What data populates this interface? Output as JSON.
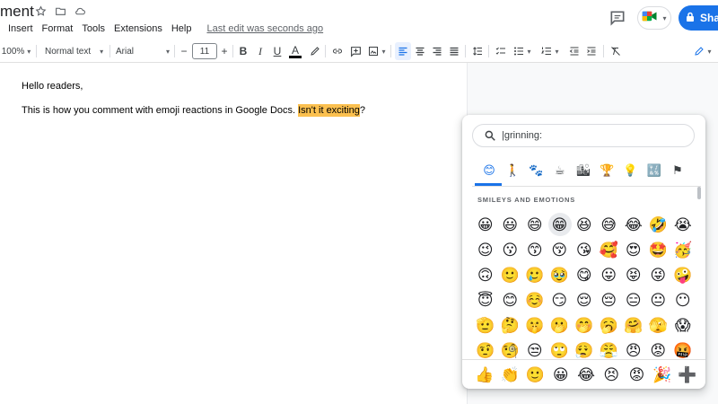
{
  "doc": {
    "title_fragment": "ment",
    "last_edit": "Last edit was seconds ago",
    "paragraph1": "Hello readers,",
    "paragraph2_plain": "This is how you comment with emoji reactions in Google Docs. ",
    "paragraph2_highlight": "Isn't it exciting",
    "paragraph2_end": "?"
  },
  "menu": [
    "Insert",
    "Format",
    "Tools",
    "Extensions",
    "Help"
  ],
  "share_label": "Shar",
  "toolbar": {
    "zoom": "100%",
    "style": "Normal text",
    "font": "Arial",
    "font_size": "11",
    "minus": "−",
    "plus": "+",
    "bold": "B",
    "italic": "I",
    "underline": "U",
    "text_color": "A"
  },
  "emoji_picker": {
    "search_value": "|grinning:",
    "section_title": "SMILEYS AND EMOTIONS",
    "categories": [
      "😊",
      "🚶",
      "🐾",
      "☕",
      "🏙",
      "🏆",
      "💡",
      "🔣",
      "⚑"
    ],
    "emojis": [
      "😀",
      "😃",
      "😄",
      "😁",
      "😆",
      "😅",
      "😂",
      "🤣",
      "😭",
      "😉",
      "😗",
      "😙",
      "😚",
      "😘",
      "🥰",
      "😍",
      "🤩",
      "🥳",
      "🙃",
      "🙂",
      "🥲",
      "🥹",
      "😋",
      "😛",
      "😝",
      "😜",
      "🤪",
      "😇",
      "😊",
      "☺️",
      "😏",
      "😌",
      "😔",
      "😑",
      "😐",
      "😶",
      "🫡",
      "🤔",
      "🤫",
      "🫢",
      "🤭",
      "🥱",
      "🤗",
      "🫣",
      "😱",
      "🤨",
      "🧐",
      "😒",
      "🙄",
      "😮‍💨",
      "😤",
      "😠",
      "😡",
      "🤬"
    ],
    "recent": [
      "👍",
      "👏",
      "🙂",
      "😀",
      "😂",
      "😣",
      "😡",
      "🎉",
      "➕"
    ]
  },
  "colors": {
    "accent": "#1a73e8",
    "highlight": "#fbc04f"
  }
}
